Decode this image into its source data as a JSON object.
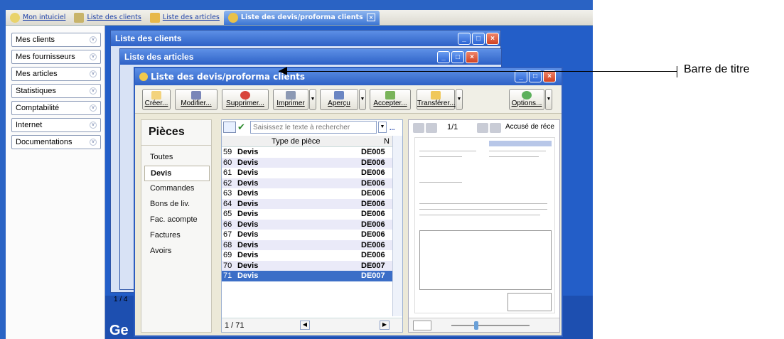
{
  "tabs": [
    {
      "label": "Mon intuiciel"
    },
    {
      "label": "Liste des clients"
    },
    {
      "label": "Liste des articles"
    },
    {
      "label": "Liste des devis/proforma clients"
    }
  ],
  "sidebar": {
    "items": [
      {
        "label": "Mes clients"
      },
      {
        "label": "Mes fournisseurs"
      },
      {
        "label": "Mes articles"
      },
      {
        "label": "Statistiques"
      },
      {
        "label": "Comptabilité"
      },
      {
        "label": "Internet"
      },
      {
        "label": "Documentations"
      }
    ]
  },
  "windows": {
    "clients_title": "Liste des clients",
    "articles_title": "Liste des articles",
    "devis_title": "Liste des devis/proforma clients"
  },
  "toolbar": {
    "create": "Créer...",
    "modify": "Modifier...",
    "delete": "Supprimer...",
    "print": "Imprimer",
    "preview": "Aperçu",
    "accept": "Accepter...",
    "transfer": "Transférer...",
    "options": "Options..."
  },
  "pieces": {
    "title": "Pièces",
    "items": [
      "Toutes",
      "Devis",
      "Commandes",
      "Bons de liv.",
      "Fac. acompte",
      "Factures",
      "Avoirs"
    ],
    "selected": "Devis"
  },
  "search": {
    "placeholder": "Saisissez le texte à rechercher"
  },
  "list": {
    "col_type": "Type de pièce",
    "col_n": "N",
    "rows": [
      {
        "n": "59",
        "type": "Devis",
        "code": "DE005"
      },
      {
        "n": "60",
        "type": "Devis",
        "code": "DE006"
      },
      {
        "n": "61",
        "type": "Devis",
        "code": "DE006"
      },
      {
        "n": "62",
        "type": "Devis",
        "code": "DE006"
      },
      {
        "n": "63",
        "type": "Devis",
        "code": "DE006"
      },
      {
        "n": "64",
        "type": "Devis",
        "code": "DE006"
      },
      {
        "n": "65",
        "type": "Devis",
        "code": "DE006"
      },
      {
        "n": "66",
        "type": "Devis",
        "code": "DE006"
      },
      {
        "n": "67",
        "type": "Devis",
        "code": "DE006"
      },
      {
        "n": "68",
        "type": "Devis",
        "code": "DE006"
      },
      {
        "n": "69",
        "type": "Devis",
        "code": "DE006"
      },
      {
        "n": "70",
        "type": "Devis",
        "code": "DE007"
      },
      {
        "n": "71",
        "type": "Devis",
        "code": "DE007"
      }
    ],
    "pager": "1 / 71"
  },
  "preview": {
    "page": "1/1",
    "label": "Accusé de réce"
  },
  "behind": {
    "list_pager": "1 / 4"
  },
  "brand_fragment": "Ge",
  "annotation": {
    "label": "Barre de titre"
  }
}
